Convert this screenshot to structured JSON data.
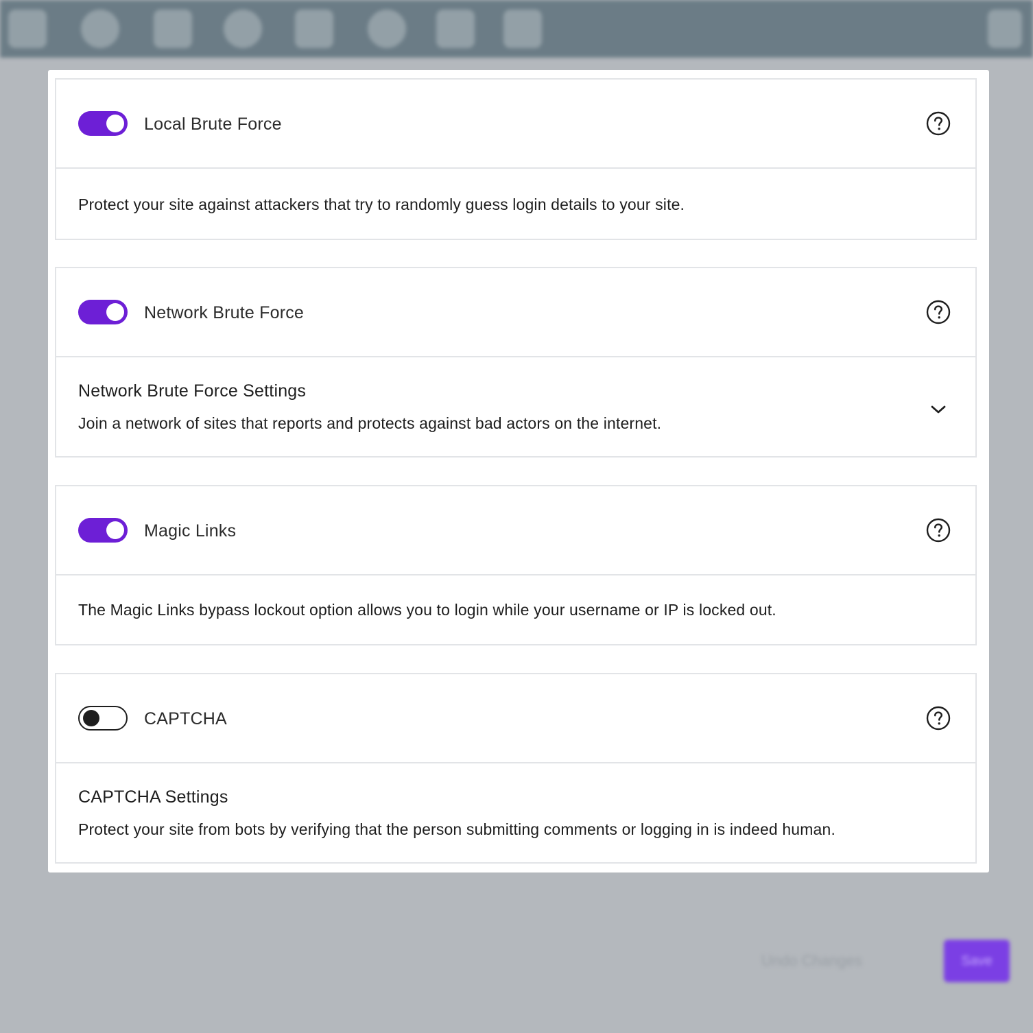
{
  "background": {
    "toolbar_icons": [
      "menu-icon",
      "globe-icon",
      "home-icon",
      "settings-icon",
      "shield-icon",
      "add-icon",
      "copy-icon",
      "badge-icon",
      "user-icon"
    ],
    "footer_link": "Undo Changes",
    "save_button": "Save"
  },
  "accent_color": "#6d1fd6",
  "sections": [
    {
      "title": "Local Brute Force",
      "enabled": true,
      "description": "Protect your site against attackers that try to randomly guess login details to your site."
    },
    {
      "title": "Network Brute Force",
      "enabled": true,
      "settings_title": "Network Brute Force Settings",
      "description": "Join a network of sites that reports and protects against bad actors on the internet."
    },
    {
      "title": "Magic Links",
      "enabled": true,
      "description": "The Magic Links bypass lockout option allows you to login while your username or IP is locked out."
    },
    {
      "title": "CAPTCHA",
      "enabled": false,
      "settings_title": "CAPTCHA Settings",
      "description": "Protect your site from bots by verifying that the person submitting comments or logging in is indeed human."
    }
  ]
}
